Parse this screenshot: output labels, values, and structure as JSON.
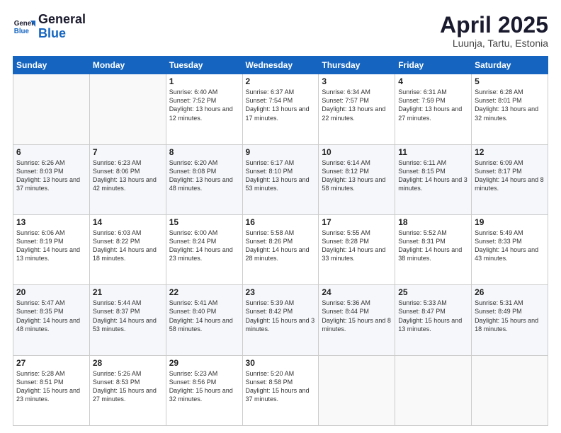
{
  "header": {
    "logo_line1": "General",
    "logo_line2": "Blue",
    "title": "April 2025",
    "subtitle": "Luunja, Tartu, Estonia"
  },
  "days_of_week": [
    "Sunday",
    "Monday",
    "Tuesday",
    "Wednesday",
    "Thursday",
    "Friday",
    "Saturday"
  ],
  "weeks": [
    [
      {
        "day": "",
        "empty": true
      },
      {
        "day": "",
        "empty": true
      },
      {
        "day": "1",
        "sunrise": "6:40 AM",
        "sunset": "7:52 PM",
        "daylight": "13 hours and 12 minutes."
      },
      {
        "day": "2",
        "sunrise": "6:37 AM",
        "sunset": "7:54 PM",
        "daylight": "13 hours and 17 minutes."
      },
      {
        "day": "3",
        "sunrise": "6:34 AM",
        "sunset": "7:57 PM",
        "daylight": "13 hours and 22 minutes."
      },
      {
        "day": "4",
        "sunrise": "6:31 AM",
        "sunset": "7:59 PM",
        "daylight": "13 hours and 27 minutes."
      },
      {
        "day": "5",
        "sunrise": "6:28 AM",
        "sunset": "8:01 PM",
        "daylight": "13 hours and 32 minutes."
      }
    ],
    [
      {
        "day": "6",
        "sunrise": "6:26 AM",
        "sunset": "8:03 PM",
        "daylight": "13 hours and 37 minutes."
      },
      {
        "day": "7",
        "sunrise": "6:23 AM",
        "sunset": "8:06 PM",
        "daylight": "13 hours and 42 minutes."
      },
      {
        "day": "8",
        "sunrise": "6:20 AM",
        "sunset": "8:08 PM",
        "daylight": "13 hours and 48 minutes."
      },
      {
        "day": "9",
        "sunrise": "6:17 AM",
        "sunset": "8:10 PM",
        "daylight": "13 hours and 53 minutes."
      },
      {
        "day": "10",
        "sunrise": "6:14 AM",
        "sunset": "8:12 PM",
        "daylight": "13 hours and 58 minutes."
      },
      {
        "day": "11",
        "sunrise": "6:11 AM",
        "sunset": "8:15 PM",
        "daylight": "14 hours and 3 minutes."
      },
      {
        "day": "12",
        "sunrise": "6:09 AM",
        "sunset": "8:17 PM",
        "daylight": "14 hours and 8 minutes."
      }
    ],
    [
      {
        "day": "13",
        "sunrise": "6:06 AM",
        "sunset": "8:19 PM",
        "daylight": "14 hours and 13 minutes."
      },
      {
        "day": "14",
        "sunrise": "6:03 AM",
        "sunset": "8:22 PM",
        "daylight": "14 hours and 18 minutes."
      },
      {
        "day": "15",
        "sunrise": "6:00 AM",
        "sunset": "8:24 PM",
        "daylight": "14 hours and 23 minutes."
      },
      {
        "day": "16",
        "sunrise": "5:58 AM",
        "sunset": "8:26 PM",
        "daylight": "14 hours and 28 minutes."
      },
      {
        "day": "17",
        "sunrise": "5:55 AM",
        "sunset": "8:28 PM",
        "daylight": "14 hours and 33 minutes."
      },
      {
        "day": "18",
        "sunrise": "5:52 AM",
        "sunset": "8:31 PM",
        "daylight": "14 hours and 38 minutes."
      },
      {
        "day": "19",
        "sunrise": "5:49 AM",
        "sunset": "8:33 PM",
        "daylight": "14 hours and 43 minutes."
      }
    ],
    [
      {
        "day": "20",
        "sunrise": "5:47 AM",
        "sunset": "8:35 PM",
        "daylight": "14 hours and 48 minutes."
      },
      {
        "day": "21",
        "sunrise": "5:44 AM",
        "sunset": "8:37 PM",
        "daylight": "14 hours and 53 minutes."
      },
      {
        "day": "22",
        "sunrise": "5:41 AM",
        "sunset": "8:40 PM",
        "daylight": "14 hours and 58 minutes."
      },
      {
        "day": "23",
        "sunrise": "5:39 AM",
        "sunset": "8:42 PM",
        "daylight": "15 hours and 3 minutes."
      },
      {
        "day": "24",
        "sunrise": "5:36 AM",
        "sunset": "8:44 PM",
        "daylight": "15 hours and 8 minutes."
      },
      {
        "day": "25",
        "sunrise": "5:33 AM",
        "sunset": "8:47 PM",
        "daylight": "15 hours and 13 minutes."
      },
      {
        "day": "26",
        "sunrise": "5:31 AM",
        "sunset": "8:49 PM",
        "daylight": "15 hours and 18 minutes."
      }
    ],
    [
      {
        "day": "27",
        "sunrise": "5:28 AM",
        "sunset": "8:51 PM",
        "daylight": "15 hours and 23 minutes."
      },
      {
        "day": "28",
        "sunrise": "5:26 AM",
        "sunset": "8:53 PM",
        "daylight": "15 hours and 27 minutes."
      },
      {
        "day": "29",
        "sunrise": "5:23 AM",
        "sunset": "8:56 PM",
        "daylight": "15 hours and 32 minutes."
      },
      {
        "day": "30",
        "sunrise": "5:20 AM",
        "sunset": "8:58 PM",
        "daylight": "15 hours and 37 minutes."
      },
      {
        "day": "",
        "empty": true
      },
      {
        "day": "",
        "empty": true
      },
      {
        "day": "",
        "empty": true
      }
    ]
  ]
}
